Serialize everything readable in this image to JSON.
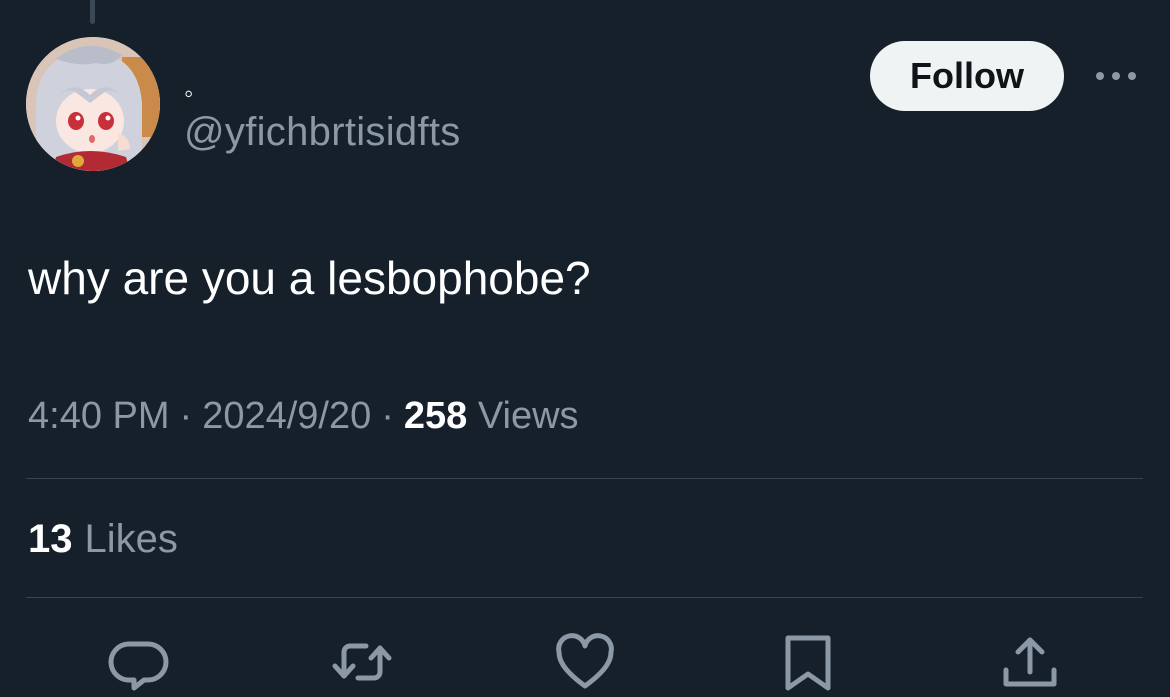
{
  "author": {
    "display_name": "◦",
    "handle": "@yfichbrtisidfts",
    "avatar_icon": "anime-avatar"
  },
  "follow_button": {
    "label": "Follow"
  },
  "more_button": {
    "icon": "more-horizontal-icon"
  },
  "tweet": {
    "text": "why are you a lesbophobe?"
  },
  "meta": {
    "time": "4:40 PM",
    "date": "2024/9/20",
    "separator": "·",
    "views_count": "258",
    "views_label": "Views"
  },
  "stats": {
    "likes_count": "13",
    "likes_label": "Likes"
  },
  "actions": [
    {
      "icon": "reply-icon"
    },
    {
      "icon": "retweet-icon"
    },
    {
      "icon": "like-icon"
    },
    {
      "icon": "bookmark-icon"
    },
    {
      "icon": "share-icon"
    }
  ],
  "colors": {
    "background": "#15202b",
    "text_primary": "#ffffff",
    "text_secondary": "#8b98a5",
    "divider": "#38444d",
    "follow_bg": "#eff3f4"
  }
}
